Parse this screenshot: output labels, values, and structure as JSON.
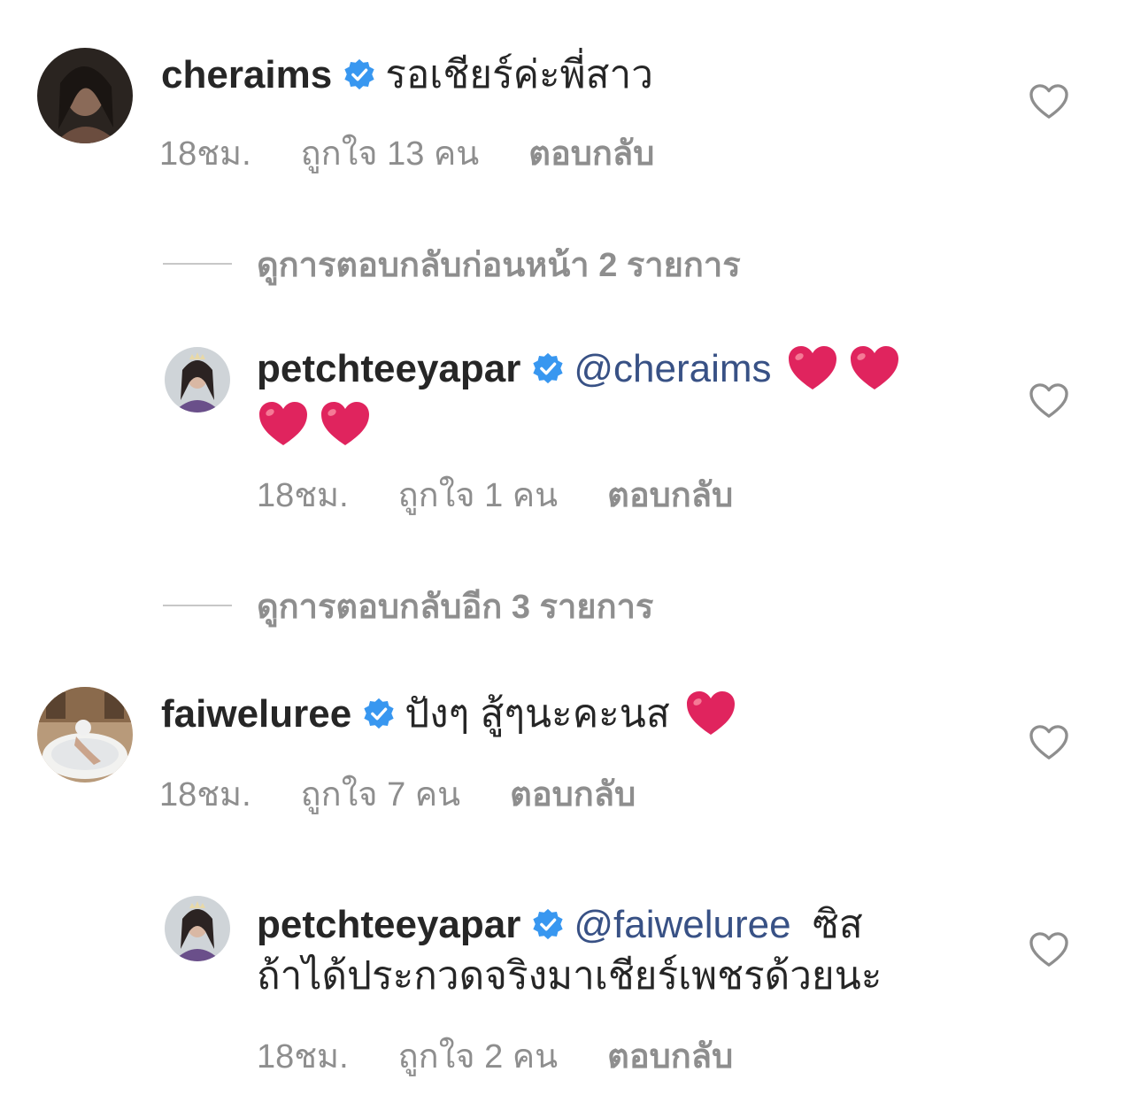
{
  "colors": {
    "text": "#262626",
    "meta": "#8e8e8e",
    "mention": "#385185",
    "verified": "#3897f0",
    "heart": "#e0245e"
  },
  "comments": [
    {
      "username": "cheraims",
      "verified": true,
      "text": "รอเชียร์ค่ะพี่สาว",
      "time": "18ชม.",
      "likes": "ถูกใจ 13 คน",
      "reply": "ตอบกลับ"
    },
    {
      "username": "petchteeyapar",
      "verified": true,
      "mention": "@cheraims",
      "emojis": [
        "heart-emoji",
        "heart-emoji",
        "heart-emoji",
        "heart-emoji"
      ],
      "time": "18ชม.",
      "likes": "ถูกใจ 1 คน",
      "reply": "ตอบกลับ"
    },
    {
      "username": "faiweluree",
      "verified": true,
      "text": "ปังๆ สู้ๆนะคะนส",
      "emojis": [
        "heart-emoji"
      ],
      "time": "18ชม.",
      "likes": "ถูกใจ 7 คน",
      "reply": "ตอบกลับ"
    },
    {
      "username": "petchteeyapar",
      "verified": true,
      "mention": "@faiweluree",
      "text_line1": "ซิส",
      "text_line2": "ถ้าได้ประกวดจริงมาเชียร์เพชรด้วยนะ",
      "time": "18ชม.",
      "likes": "ถูกใจ 2 คน",
      "reply": "ตอบกลับ"
    }
  ],
  "view_previous_replies": "ดูการตอบกลับก่อนหน้า 2 รายการ",
  "view_more_replies": "ดูการตอบกลับอีก 3 รายการ"
}
